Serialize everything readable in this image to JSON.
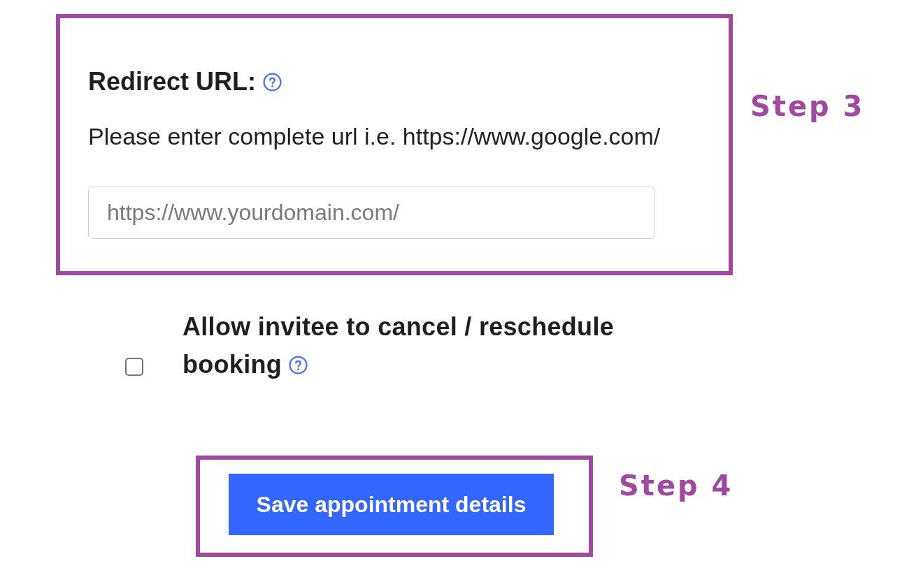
{
  "redirect_section": {
    "label": "Redirect URL:",
    "description": "Please enter complete url i.e. https://www.google.com/",
    "url_field": {
      "placeholder": "https://www.yourdomain.com/"
    },
    "step_label": "Step 3"
  },
  "cancel_option": {
    "label_lines": [
      "Allow invitee to cancel / reschedule",
      "booking"
    ],
    "checked": false
  },
  "save_section": {
    "button": "Save appointment details",
    "step_label": "Step 4"
  }
}
